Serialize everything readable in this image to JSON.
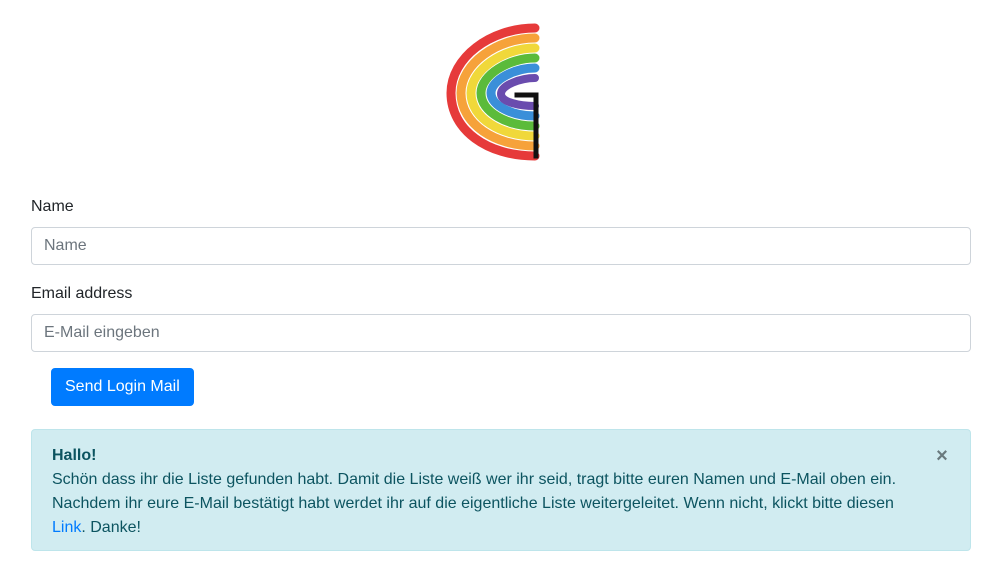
{
  "logo": {
    "icon": "rainbow-g-logo",
    "colors": [
      "#e63a3a",
      "#f6a23a",
      "#f0d83a",
      "#5bbb3a",
      "#3a8fd9",
      "#6a4cae",
      "#111111"
    ]
  },
  "form": {
    "name_label": "Name",
    "name_placeholder": "Name",
    "name_value": "",
    "email_label": "Email address",
    "email_placeholder": "E-Mail eingeben",
    "email_value": "",
    "submit_label": "Send Login Mail"
  },
  "alert": {
    "title": "Hallo!",
    "text_before_link": "Schön dass ihr die Liste gefunden habt. Damit die Liste weiß wer ihr seid, tragt bitte euren Namen und E-Mail oben ein. Nachdem ihr eure E-Mail bestätigt habt werdet ihr auf die eigentliche Liste weitergeleitet. Wenn nicht, klickt bitte diesen ",
    "link_label": "Link",
    "text_after_link": ". Danke!",
    "close_label": "×"
  },
  "colors": {
    "primary": "#007bff",
    "alert_bg": "#d1ecf1",
    "alert_text": "#0c5460"
  }
}
